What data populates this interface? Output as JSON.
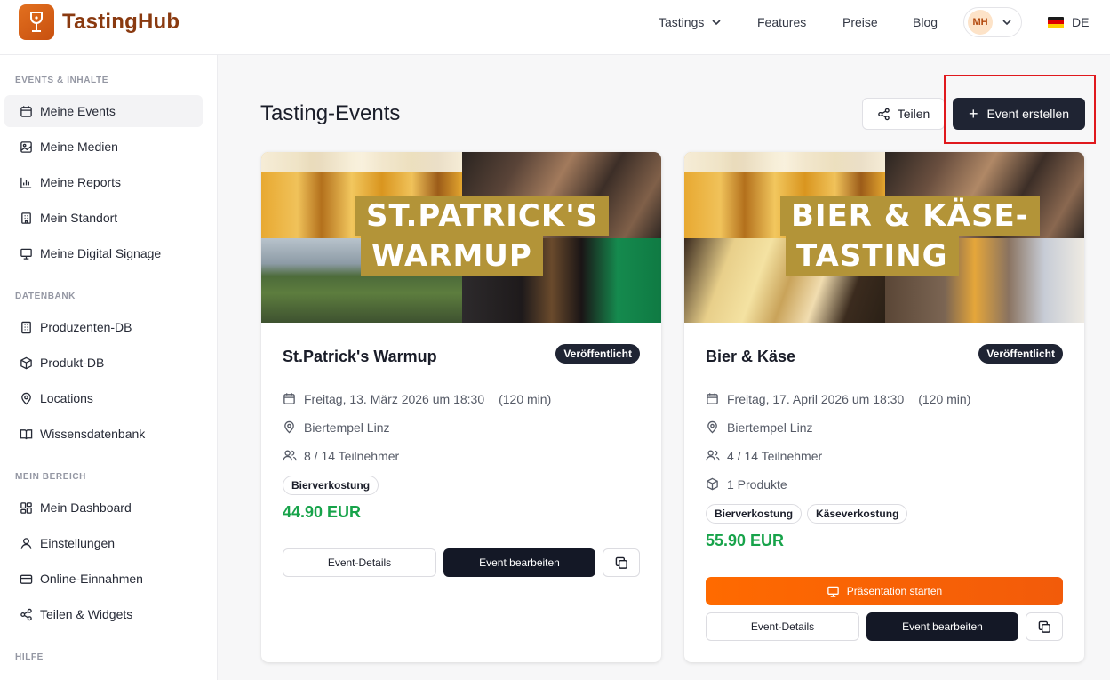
{
  "app": {
    "name": "TastingHub"
  },
  "nav": {
    "tastings": "Tastings",
    "features": "Features",
    "preise": "Preise",
    "blog": "Blog",
    "user_initials": "MH",
    "language": "DE"
  },
  "sidebar": {
    "sections": [
      {
        "label": "EVENTS & INHALTE"
      },
      {
        "label": "DATENBANK"
      },
      {
        "label": "MEIN BEREICH"
      },
      {
        "label": "HILFE"
      }
    ],
    "items": [
      {
        "label": "Meine Events",
        "icon": "calendar-icon"
      },
      {
        "label": "Meine Medien",
        "icon": "image-icon"
      },
      {
        "label": "Meine Reports",
        "icon": "bar-chart-icon"
      },
      {
        "label": "Mein Standort",
        "icon": "building-icon"
      },
      {
        "label": "Meine Digital Signage",
        "icon": "monitor-icon"
      },
      {
        "label": "Produzenten-DB",
        "icon": "office-icon"
      },
      {
        "label": "Produkt-DB",
        "icon": "package-icon"
      },
      {
        "label": "Locations",
        "icon": "pin-icon"
      },
      {
        "label": "Wissensdatenbank",
        "icon": "book-icon"
      },
      {
        "label": "Mein Dashboard",
        "icon": "dashboard-icon"
      },
      {
        "label": "Einstellungen",
        "icon": "user-icon"
      },
      {
        "label": "Online-Einnahmen",
        "icon": "credit-card-icon"
      },
      {
        "label": "Teilen & Widgets",
        "icon": "share-icon"
      }
    ]
  },
  "main": {
    "title": "Tasting-Events",
    "share_label": "Teilen",
    "create_label": "Event erstellen"
  },
  "events": [
    {
      "banner_line1": "ST.PATRICK'S",
      "banner_line2": "WARMUP",
      "title": "St.Patrick's Warmup",
      "status": "Veröffentlicht",
      "date": "Freitag, 13. März 2026 um 18:30",
      "duration": "(120 min)",
      "location": "Biertempel Linz",
      "participants": "8 / 14 Teilnehmer",
      "tags": [
        "Bierverkostung"
      ],
      "price": "44.90 EUR",
      "details_label": "Event-Details",
      "edit_label": "Event bearbeiten"
    },
    {
      "banner_line1": "BIER & KÄSE-",
      "banner_line2": "TASTING",
      "title": "Bier & Käse",
      "status": "Veröffentlicht",
      "date": "Freitag, 17. April 2026 um 18:30",
      "duration": "(120 min)",
      "location": "Biertempel Linz",
      "participants": "4 / 14 Teilnehmer",
      "products": "1 Produkte",
      "tags": [
        "Bierverkostung",
        "Käseverkostung"
      ],
      "price": "55.90 EUR",
      "present_label": "Präsentation starten",
      "details_label": "Event-Details",
      "edit_label": "Event bearbeiten"
    }
  ],
  "colors": {
    "accent": "#1f2433",
    "price": "#17a34a",
    "present": "#ff6a00",
    "banner_gold": "#b39438",
    "highlight": "#e0191e"
  }
}
